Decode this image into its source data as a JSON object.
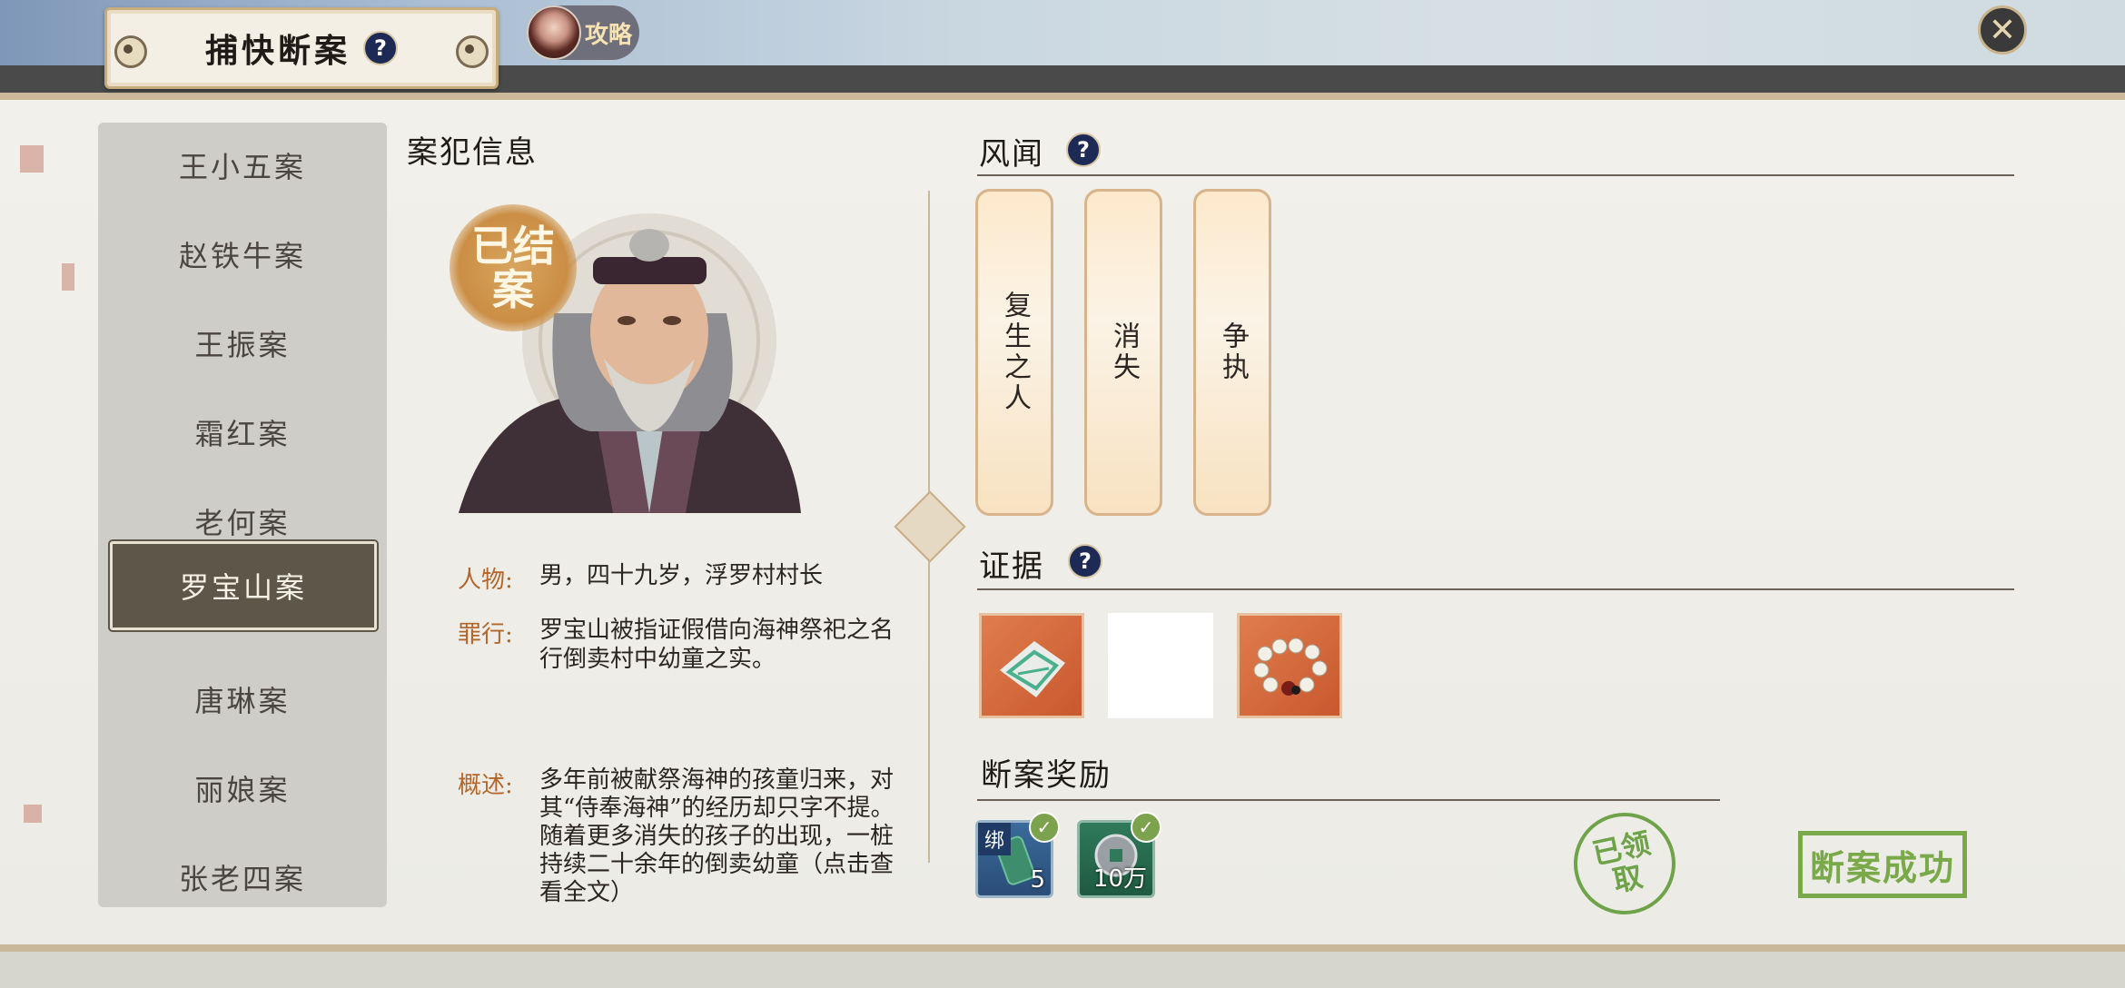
{
  "header": {
    "title": "捕快断案",
    "guide_label": "攻略"
  },
  "case_list": [
    {
      "label": "王小五案"
    },
    {
      "label": "赵铁牛案"
    },
    {
      "label": "王振案"
    },
    {
      "label": "霜红案"
    },
    {
      "label": "老何案"
    },
    {
      "label": "罗宝山案",
      "selected": true
    },
    {
      "label": "唐琳案"
    },
    {
      "label": "丽娘案"
    },
    {
      "label": "张老四案"
    }
  ],
  "suspect": {
    "section_title": "案犯信息",
    "status_stamp": "已结案",
    "person_label": "人物:",
    "person_value": "男，四十九岁，浮罗村村长",
    "crime_label": "罪行:",
    "crime_value": "罗宝山被指证假借向海神祭祀之名行倒卖村中幼童之实。",
    "summary_label": "概述:",
    "summary_value": "多年前被献祭海神的孩童归来，对其“侍奉海神”的经历却只字不提。随着更多消失的孩子的出现，一桩持续二十余年的倒卖幼童（点击查看全文）"
  },
  "rumors": {
    "section_title": "风闻",
    "cards": [
      {
        "text": "复生之人"
      },
      {
        "text": "消失"
      },
      {
        "text": "争执"
      }
    ]
  },
  "evidence": {
    "section_title": "证据",
    "items": [
      {
        "icon": "torn-paper-icon"
      },
      {
        "icon": "empty-slot"
      },
      {
        "icon": "prayer-beads-icon"
      }
    ]
  },
  "rewards": {
    "section_title": "断案奖励",
    "items": [
      {
        "icon": "jade-token-icon",
        "tag": "绑",
        "count": "5",
        "claimed": true
      },
      {
        "icon": "silver-coin-icon",
        "count": "10万",
        "claimed": true
      }
    ],
    "claimed_stamp": "已领取",
    "success_stamp": "断案成功"
  },
  "colors": {
    "accent_orange": "#b3662b",
    "selected_bg": "#5e5648",
    "stamp_green": "#7aa94a"
  }
}
